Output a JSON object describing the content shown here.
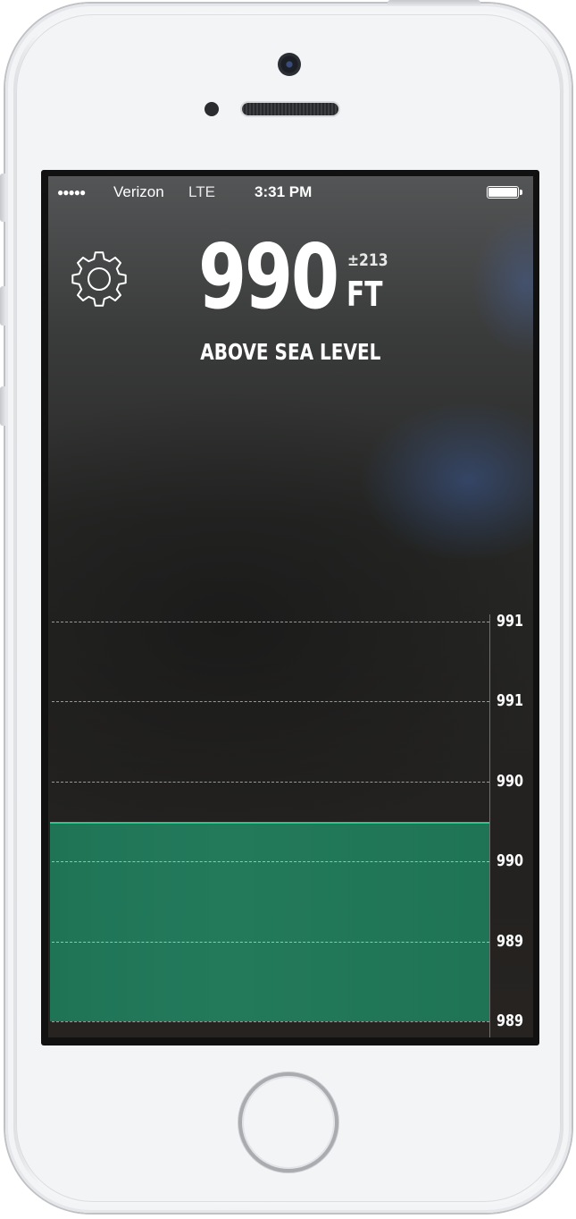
{
  "status_bar": {
    "signal": "●●●●●",
    "carrier": "Verizon",
    "network": "LTE",
    "time": "3:31 PM",
    "battery_level": 1.0
  },
  "header": {
    "settings_icon": "gear-icon",
    "altitude_value": "990",
    "accuracy": "±213",
    "unit": "FT",
    "caption": "ABOVE SEA LEVEL"
  },
  "chart_data": {
    "type": "area",
    "tick_labels": [
      "991",
      "991",
      "990",
      "990",
      "989",
      "989"
    ],
    "fill_level_fraction": 0.5,
    "fill_color": "#1f7456",
    "line_color": "#2ec48b",
    "grid": "dashed"
  }
}
